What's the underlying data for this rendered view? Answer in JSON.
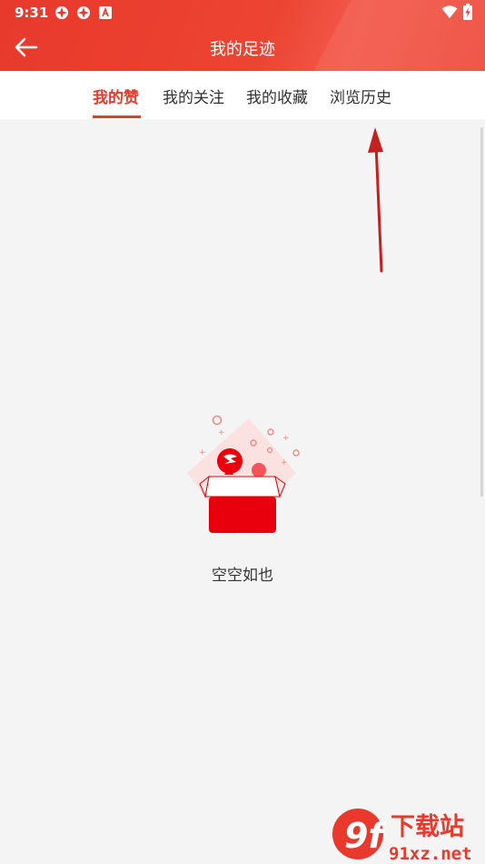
{
  "status_bar": {
    "time": "9:31",
    "icons_left": [
      "app-notification-icon",
      "app-notification-icon",
      "a-badge-icon"
    ],
    "icons_right": [
      "wifi-icon",
      "battery-charging-icon"
    ]
  },
  "header": {
    "title": "我的足迹",
    "back_icon": "arrow-left-icon",
    "color": "#e8392c"
  },
  "tabs": [
    {
      "label": "我的赞",
      "active": true
    },
    {
      "label": "我的关注",
      "active": false
    },
    {
      "label": "我的收藏",
      "active": false
    },
    {
      "label": "浏览历史",
      "active": false
    }
  ],
  "empty_state": {
    "message": "空空如也",
    "icon": "empty-box-icon"
  },
  "watermark": {
    "logo": "9f",
    "text_top": "下载站",
    "text_bottom": "91xz.net"
  },
  "colors": {
    "accent": "#e8392c",
    "background": "#f4f4f4",
    "tab_text": "#333333"
  }
}
